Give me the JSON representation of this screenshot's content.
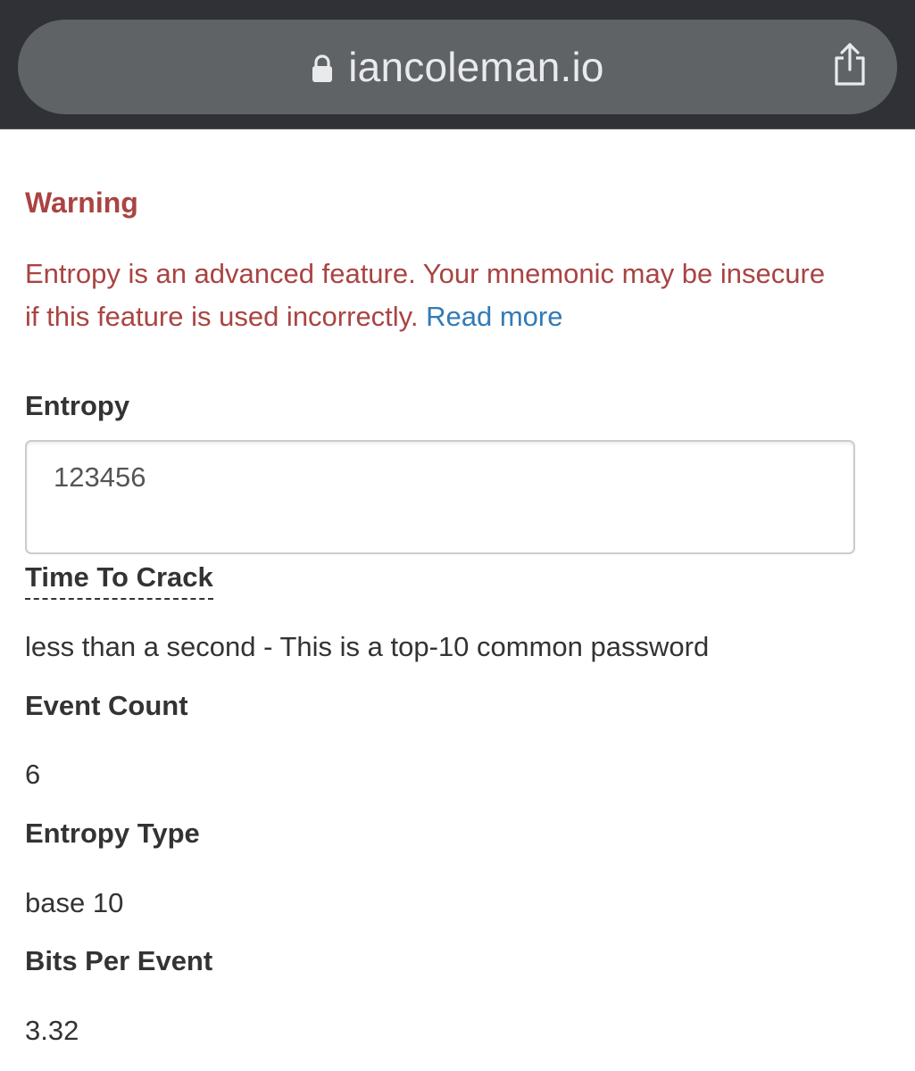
{
  "browser": {
    "url": "iancoleman.io",
    "lock_icon": "lock-icon",
    "share_icon": "share-icon"
  },
  "warning": {
    "title": "Warning",
    "text": "Entropy is an advanced feature. Your mnemonic may be insecure if this feature is used incorrectly.",
    "link": "Read more"
  },
  "entropy": {
    "label": "Entropy",
    "value": "123456"
  },
  "time_to_crack": {
    "label": "Time To Crack",
    "value": "less than a second - This is a top-10 common password"
  },
  "event_count": {
    "label": "Event Count",
    "value": "6"
  },
  "entropy_type": {
    "label": "Entropy Type",
    "value": "base 10"
  },
  "bits_per_event": {
    "label": "Bits Per Event",
    "value": "3.32"
  },
  "colors": {
    "warning": "#a94442",
    "link": "#337ab7",
    "browser_bar": "#2f3136",
    "url_pill": "#5f6366"
  }
}
